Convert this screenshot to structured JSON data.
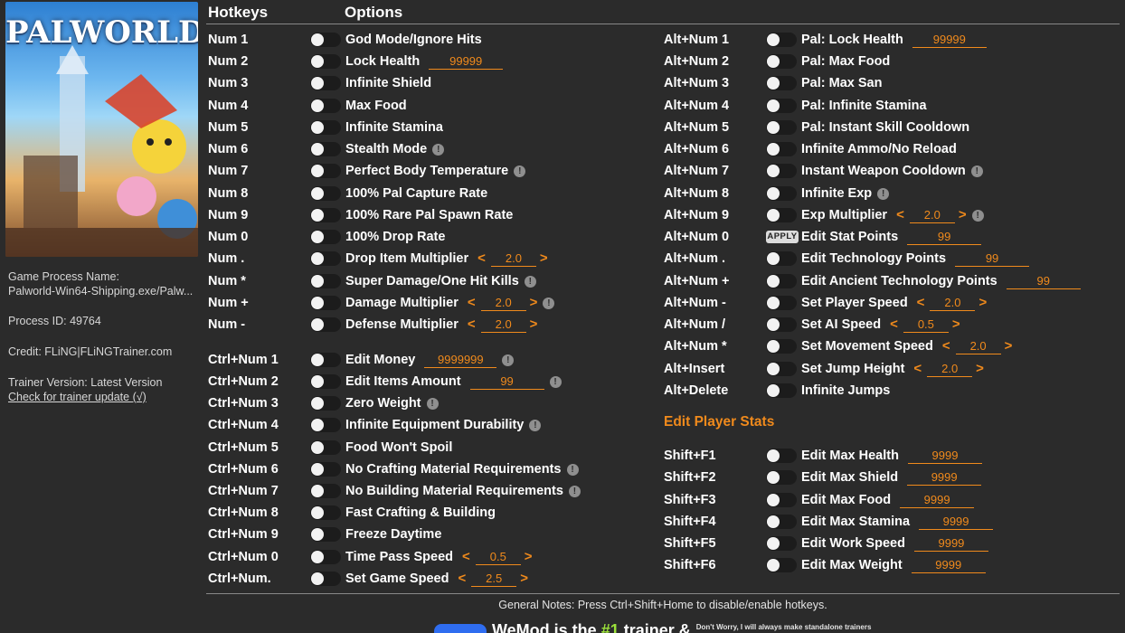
{
  "sidebar": {
    "game_title": "PALWORLD",
    "process_name_label": "Game Process Name:",
    "process_name": "Palworld-Win64-Shipping.exe/Palw...",
    "process_id": "Process ID: 49764",
    "credit": "Credit: FLiNG|FLiNGTrainer.com",
    "trainer_version": "Trainer Version: Latest Version",
    "update_link": "Check for trainer update (√)"
  },
  "header": {
    "hotkeys": "Hotkeys",
    "options": "Options"
  },
  "left_rows": [
    {
      "hk": "Num 1",
      "opt": "God Mode/Ignore Hits"
    },
    {
      "hk": "Num 2",
      "opt": "Lock Health",
      "input": "99999"
    },
    {
      "hk": "Num 3",
      "opt": "Infinite Shield"
    },
    {
      "hk": "Num 4",
      "opt": "Max Food"
    },
    {
      "hk": "Num 5",
      "opt": "Infinite Stamina"
    },
    {
      "hk": "Num 6",
      "opt": "Stealth Mode",
      "info": "!"
    },
    {
      "hk": "Num 7",
      "opt": "Perfect Body Temperature",
      "info": "!"
    },
    {
      "hk": "Num 8",
      "opt": "100% Pal Capture Rate"
    },
    {
      "hk": "Num 9",
      "opt": "100% Rare Pal Spawn Rate"
    },
    {
      "hk": "Num 0",
      "opt": "100% Drop Rate"
    },
    {
      "hk": "Num .",
      "opt": "Drop Item Multiplier",
      "stepper": "2.0"
    },
    {
      "hk": "Num *",
      "opt": "Super Damage/One Hit Kills",
      "info": "!"
    },
    {
      "hk": "Num +",
      "opt": "Damage Multiplier",
      "stepper": "2.0",
      "info": "!"
    },
    {
      "hk": "Num -",
      "opt": "Defense Multiplier",
      "stepper": "2.0"
    },
    {
      "hk": "Ctrl+Num 1",
      "opt": "Edit Money",
      "input": "9999999",
      "info": "!"
    },
    {
      "hk": "Ctrl+Num 2",
      "opt": "Edit Items Amount",
      "input": "99",
      "info": "!"
    },
    {
      "hk": "Ctrl+Num 3",
      "opt": "Zero Weight",
      "info": "!"
    },
    {
      "hk": "Ctrl+Num 4",
      "opt": "Infinite Equipment Durability",
      "info": "!"
    },
    {
      "hk": "Ctrl+Num 5",
      "opt": "Food Won't Spoil"
    },
    {
      "hk": "Ctrl+Num 6",
      "opt": "No Crafting Material Requirements",
      "info": "!"
    },
    {
      "hk": "Ctrl+Num 7",
      "opt": "No Building Material Requirements",
      "info": "!"
    },
    {
      "hk": "Ctrl+Num 8",
      "opt": "Fast Crafting & Building"
    },
    {
      "hk": "Ctrl+Num 9",
      "opt": "Freeze Daytime"
    },
    {
      "hk": "Ctrl+Num 0",
      "opt": "Time Pass Speed",
      "stepper": "0.5"
    },
    {
      "hk": "Ctrl+Num.",
      "opt": "Set Game Speed",
      "stepper": "2.5"
    }
  ],
  "right_rows": [
    {
      "hk": "Alt+Num 1",
      "opt": "Pal: Lock Health",
      "input": "99999"
    },
    {
      "hk": "Alt+Num 2",
      "opt": "Pal: Max Food"
    },
    {
      "hk": "Alt+Num 3",
      "opt": "Pal: Max San"
    },
    {
      "hk": "Alt+Num 4",
      "opt": "Pal: Infinite Stamina"
    },
    {
      "hk": "Alt+Num 5",
      "opt": "Pal: Instant Skill Cooldown"
    },
    {
      "hk": "Alt+Num 6",
      "opt": "Infinite Ammo/No Reload"
    },
    {
      "hk": "Alt+Num 7",
      "opt": "Instant Weapon Cooldown",
      "info": "!"
    },
    {
      "hk": "Alt+Num 8",
      "opt": "Infinite Exp",
      "info": "!"
    },
    {
      "hk": "Alt+Num 9",
      "opt": "Exp Multiplier",
      "stepper": "2.0",
      "info": "!"
    },
    {
      "hk": "Alt+Num 0",
      "opt": "Edit Stat Points",
      "input": "99",
      "apply": "APPLY"
    },
    {
      "hk": "Alt+Num .",
      "opt": "Edit Technology Points",
      "input": "99"
    },
    {
      "hk": "Alt+Num +",
      "opt": "Edit Ancient Technology Points",
      "input": "99"
    },
    {
      "hk": "Alt+Num -",
      "opt": "Set Player Speed",
      "stepper": "2.0"
    },
    {
      "hk": "Alt+Num /",
      "opt": "Set AI Speed",
      "stepper": "0.5"
    },
    {
      "hk": "Alt+Num *",
      "opt": "Set Movement Speed",
      "stepper": "2.0"
    },
    {
      "hk": "Alt+Insert",
      "opt": "Set Jump Height",
      "stepper": "2.0"
    },
    {
      "hk": "Alt+Delete",
      "opt": "Infinite Jumps"
    }
  ],
  "section_title": "Edit Player Stats",
  "stat_rows": [
    {
      "hk": "Shift+F1",
      "opt": "Edit Max Health",
      "input": "9999"
    },
    {
      "hk": "Shift+F2",
      "opt": "Edit Max Shield",
      "input": "9999"
    },
    {
      "hk": "Shift+F3",
      "opt": "Edit Max Food",
      "input": "9999"
    },
    {
      "hk": "Shift+F4",
      "opt": "Edit Max Stamina",
      "input": "9999"
    },
    {
      "hk": "Shift+F5",
      "opt": "Edit Work Speed",
      "input": "9999"
    },
    {
      "hk": "Shift+F6",
      "opt": "Edit Max Weight",
      "input": "9999"
    }
  ],
  "footer": {
    "notes": "General Notes: Press Ctrl+Shift+Home to disable/enable hotkeys.",
    "promo_prefix": "WeMod is the ",
    "promo_num": "#1",
    "promo_suffix": " trainer &",
    "promo_small": "Don't Worry, I will always make standalone trainers"
  },
  "colors": {
    "accent": "#f08a1c",
    "background": "#2b2b2b",
    "info_badge": "#8f8f8f"
  }
}
